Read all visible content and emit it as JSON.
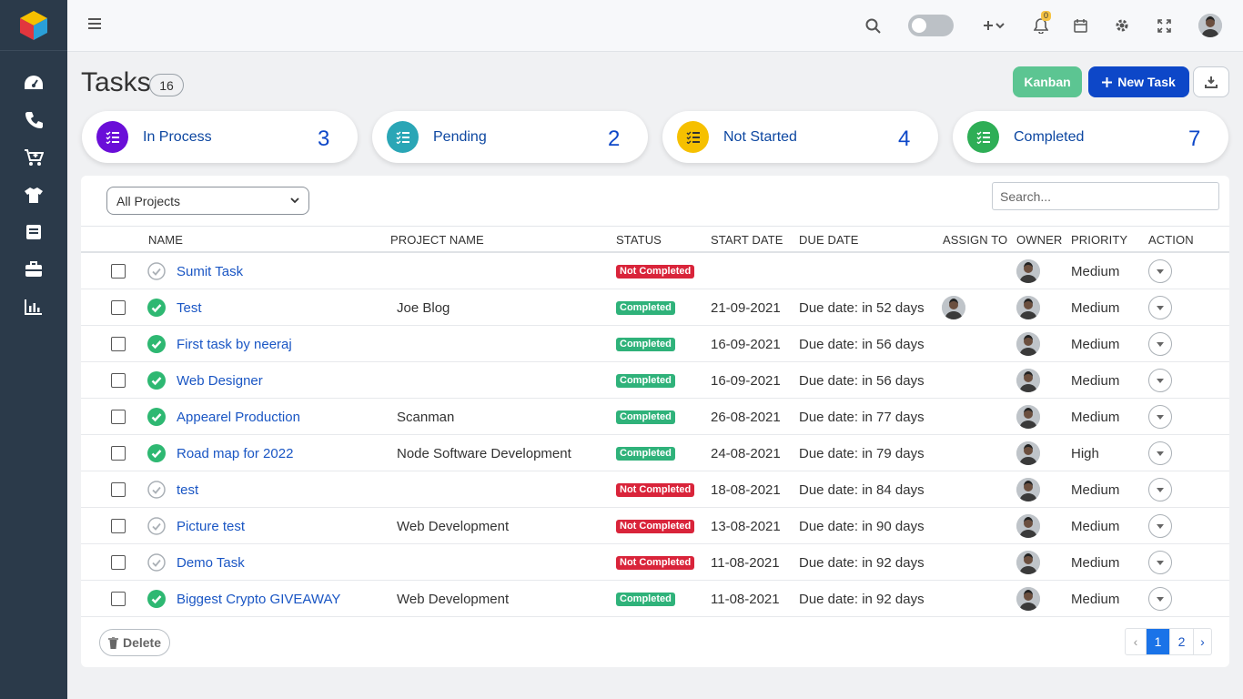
{
  "header": {
    "notification_count": "0"
  },
  "page": {
    "title": "Tasks",
    "count": "16"
  },
  "actions": {
    "kanban_label": "Kanban",
    "new_task_label": "New Task",
    "delete_label": "Delete"
  },
  "stats": [
    {
      "label": "In Process",
      "value": "3",
      "color": "#6a0ed8"
    },
    {
      "label": "Pending",
      "value": "2",
      "color": "#2aa6b6"
    },
    {
      "label": "Not Started",
      "value": "4",
      "color": "#f6c000"
    },
    {
      "label": "Completed",
      "value": "7",
      "color": "#2eae56"
    }
  ],
  "filters": {
    "project_select": "All Projects",
    "search_placeholder": "Search..."
  },
  "table": {
    "columns": [
      "NAME",
      "PROJECT NAME",
      "STATUS",
      "START DATE",
      "DUE DATE",
      "ASSIGN TO",
      "OWNER",
      "PRIORITY",
      "ACTION"
    ],
    "rows": [
      {
        "name": "Sumit Task",
        "project": "",
        "status": "Not Completed",
        "start": "",
        "due": "",
        "priority": "Medium"
      },
      {
        "name": "Test",
        "project": "Joe Blog",
        "status": "Completed",
        "start": "21-09-2021",
        "due": "Due date: in 52 days",
        "priority": "Medium"
      },
      {
        "name": "First task by neeraj",
        "project": "",
        "status": "Completed",
        "start": "16-09-2021",
        "due": "Due date: in 56 days",
        "priority": "Medium"
      },
      {
        "name": "Web Designer",
        "project": "",
        "status": "Completed",
        "start": "16-09-2021",
        "due": "Due date: in 56 days",
        "priority": "Medium"
      },
      {
        "name": "Appearel Production",
        "project": "Scanman",
        "status": "Completed",
        "start": "26-08-2021",
        "due": "Due date: in 77 days",
        "priority": "Medium"
      },
      {
        "name": "Road map for 2022",
        "project": "Node Software Development",
        "status": "Completed",
        "start": "24-08-2021",
        "due": "Due date: in 79 days",
        "priority": "High"
      },
      {
        "name": "test",
        "project": "",
        "status": "Not Completed",
        "start": "18-08-2021",
        "due": "Due date: in 84 days",
        "priority": "Medium"
      },
      {
        "name": "Picture test",
        "project": "Web Development",
        "status": "Not Completed",
        "start": "13-08-2021",
        "due": "Due date: in 90 days",
        "priority": "Medium"
      },
      {
        "name": "Demo Task",
        "project": "",
        "status": "Not Completed",
        "start": "11-08-2021",
        "due": "Due date: in 92 days",
        "priority": "Medium"
      },
      {
        "name": "Biggest Crypto GIVEAWAY",
        "project": "Web Development",
        "status": "Completed",
        "start": "11-08-2021",
        "due": "Due date: in 92 days",
        "priority": "Medium"
      }
    ]
  },
  "pagination": {
    "prev": "‹",
    "pages": [
      "1",
      "2"
    ],
    "next": "›"
  }
}
